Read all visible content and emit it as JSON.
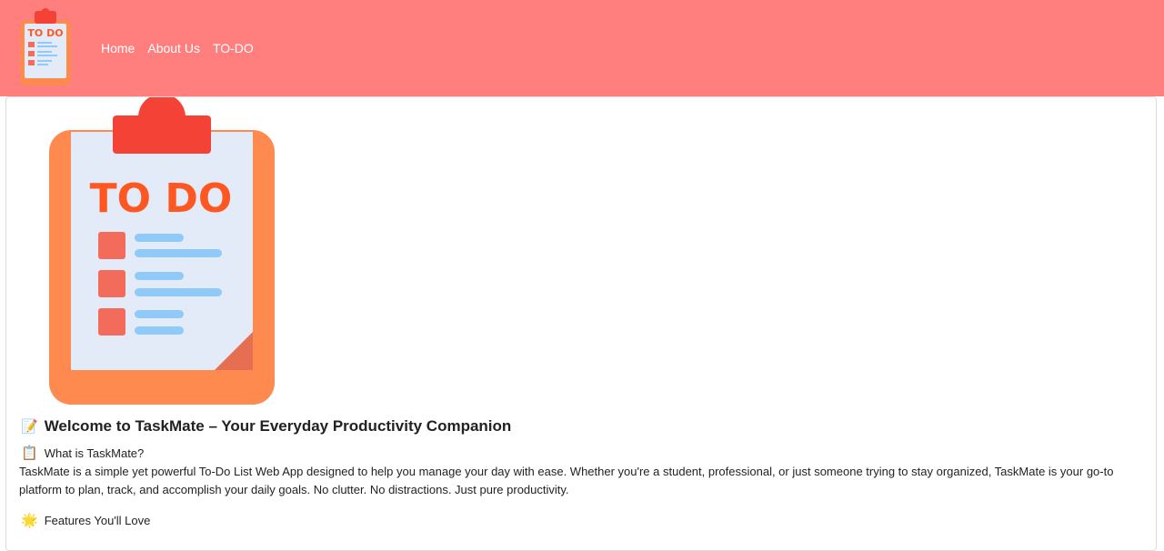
{
  "navbar": {
    "logo_text": "TO DO",
    "links": [
      "Home",
      "About Us",
      "TO-DO"
    ]
  },
  "hero": {
    "logo_text": "TO DO"
  },
  "content": {
    "welcome_emoji": "📝",
    "welcome_title": "Welcome to TaskMate – Your Everyday Productivity Companion",
    "what_emoji": "📋",
    "what_heading": "What is TaskMate?",
    "description": "TaskMate is a simple yet powerful To-Do List Web App designed to help you manage your day with ease. Whether you're a student, professional, or just someone trying to stay organized, TaskMate is your go-to platform to plan, track, and accomplish your daily goals. No clutter. No distractions. Just pure productivity.",
    "features_emoji": "🌟",
    "features_heading": "Features You'll Love"
  },
  "colors": {
    "navbar_bg": "#ff7f7f",
    "clipboard_orange": "#ff8a50",
    "clip_red": "#f44336",
    "paper": "#e3ebf8",
    "todo_text": "#ff5722",
    "check_box": "#f26b5b",
    "line_blue": "#90caf9"
  }
}
